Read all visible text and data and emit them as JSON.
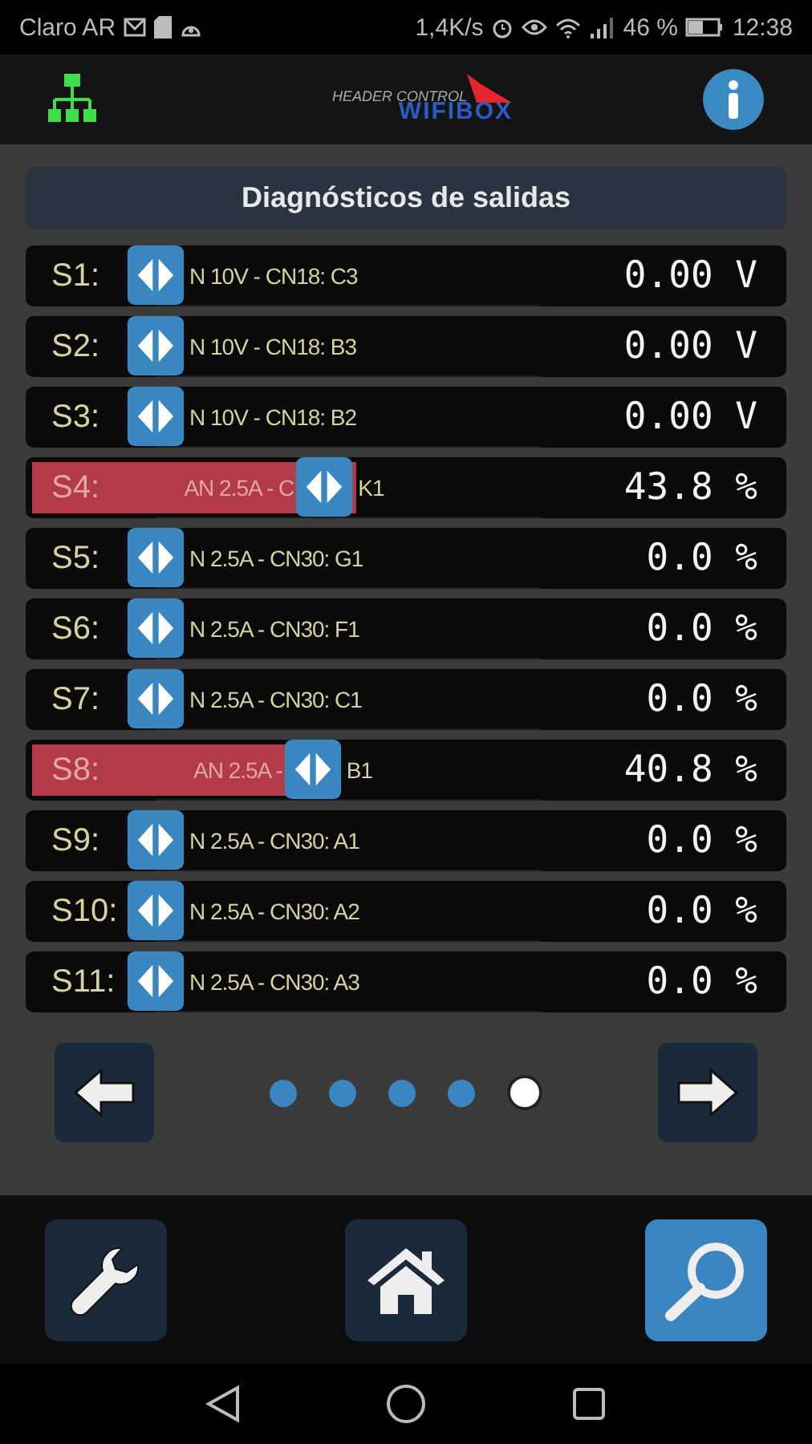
{
  "status_bar": {
    "carrier": "Claro AR",
    "speed": "1,4K/s",
    "battery": "46 %",
    "time": "12:38"
  },
  "app_bar": {
    "logo_top": "HEADER CONTROL",
    "logo_bottom": "WIFIBOX"
  },
  "title": "Diagnósticos de salidas",
  "rows": [
    {
      "label": "S1:",
      "description": [
        "N 10V - CN18: C3"
      ],
      "level": 0,
      "reading": "0.00 V"
    },
    {
      "label": "S2:",
      "description": [
        "N 10V - CN18: B3"
      ],
      "level": 0,
      "reading": "0.00 V"
    },
    {
      "label": "S3:",
      "description": [
        "N 10V - CN18: B2"
      ],
      "level": 0,
      "reading": "0.00 V"
    },
    {
      "label": "S4:",
      "description": [
        "AN 2.5A - C",
        "K1"
      ],
      "level": 0.438,
      "reading": "43.8 %"
    },
    {
      "label": "S5:",
      "description": [
        "N 2.5A - CN30: G1"
      ],
      "level": 0,
      "reading": "0.0 %"
    },
    {
      "label": "S6:",
      "description": [
        "N 2.5A - CN30: F1"
      ],
      "level": 0,
      "reading": "0.0 %"
    },
    {
      "label": "S7:",
      "description": [
        "N 2.5A - CN30: C1"
      ],
      "level": 0,
      "reading": "0.0 %"
    },
    {
      "label": "S8:",
      "description": [
        "AN 2.5A -",
        "B1"
      ],
      "level": 0.408,
      "reading": "40.8 %"
    },
    {
      "label": "S9:",
      "description": [
        "N 2.5A - CN30: A1"
      ],
      "level": 0,
      "reading": "0.0 %"
    },
    {
      "label": "S10:",
      "description": [
        "N 2.5A - CN30: A2"
      ],
      "level": 0,
      "reading": "0.0 %"
    },
    {
      "label": "S11:",
      "description": [
        "N 2.5A - CN30: A3"
      ],
      "level": 0,
      "reading": "0.0 %"
    }
  ],
  "pages": [
    {
      "selected": false
    },
    {
      "selected": false
    },
    {
      "selected": false
    },
    {
      "selected": false
    },
    {
      "selected": true
    }
  ],
  "bottom_buttons": [
    {
      "kind": "settings",
      "selected": false
    },
    {
      "kind": "home",
      "selected": false
    },
    {
      "kind": "search",
      "selected": true
    }
  ]
}
